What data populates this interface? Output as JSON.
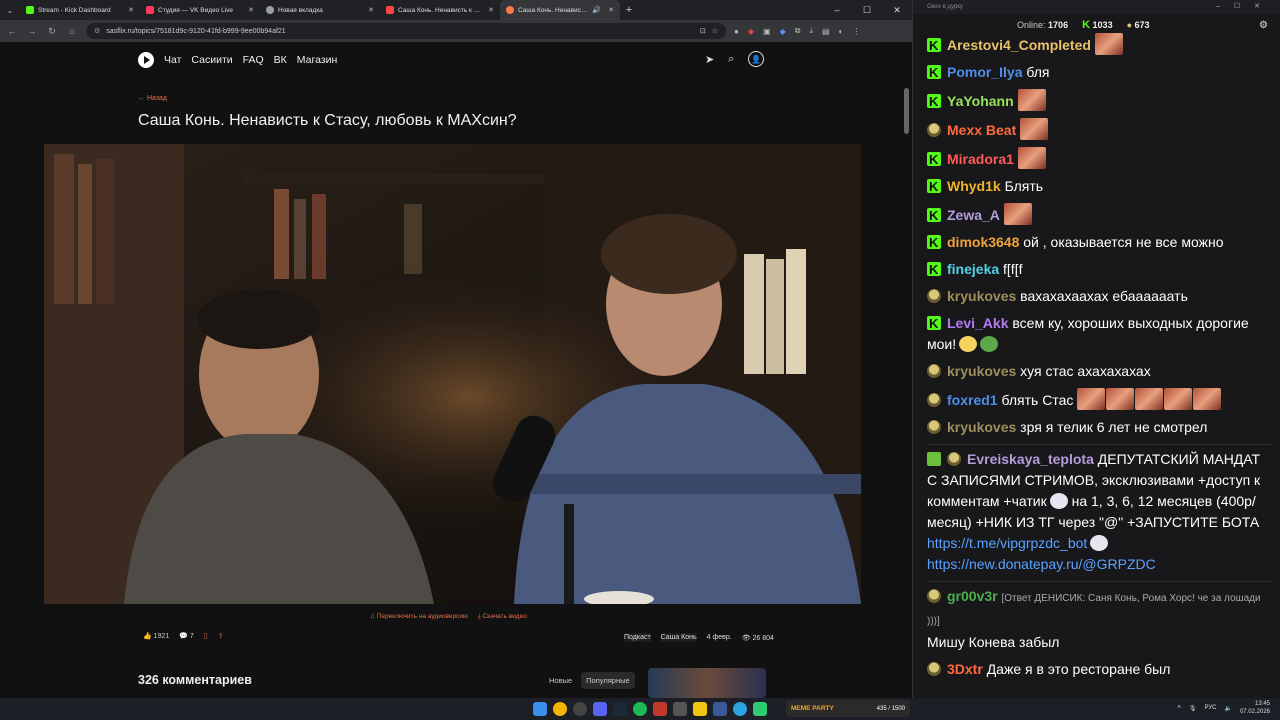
{
  "browser": {
    "tabs": [
      {
        "title": "Stream - Kick Dashboard",
        "color": "#53fc18"
      },
      {
        "title": "Студия — VK Видео Live",
        "color": "#ff3b5c"
      },
      {
        "title": "Новая вкладка",
        "color": "#9aa0a6"
      },
      {
        "title": "Саша Конь. Ненависть к Стас",
        "color": "#ff4444"
      },
      {
        "title": "Саша Конь. Ненависть к С",
        "color": "#ff7a45"
      }
    ],
    "url": "sasflix.ru/topics/75181d9c-9120-41fd-b999-9ee00b94af21"
  },
  "site": {
    "nav": [
      "Чат",
      "Сасиити",
      "FAQ",
      "ВК",
      "Магазин"
    ],
    "back": "← Назад",
    "title": "Саша Конь. Ненависть к Стасу, любовь к МАХсин?",
    "audio_link": "Переключить на аудиоверсию",
    "download_link": "Скачать видео",
    "likes": "1921",
    "comments_count_small": "7",
    "tag1": "Подкаст",
    "tag2": "Саша Конь",
    "date": "4 февр.",
    "views": "26 804",
    "comments_title": "326 комментариев",
    "sort_new": "Новые",
    "sort_popular": "Популярные"
  },
  "chat": {
    "window_title": "Окно в дурку",
    "online_label": "Online:",
    "online": "1706",
    "followers": "1033",
    "subs": "673",
    "messages": [
      {
        "badge": "kick",
        "user": "Arestovi4_Completed",
        "color": "#e8c06a",
        "text": "",
        "emotes": 1
      },
      {
        "badge": "kick",
        "user": "Pomor_Ilya",
        "color": "#4f8fea",
        "text": "бля",
        "emotes": 0
      },
      {
        "badge": "kick",
        "user": "YaYohann",
        "color": "#9be15d",
        "text": "",
        "emotes": 1
      },
      {
        "badge": "sub",
        "user": "Mexx Beat",
        "color": "#ff6a3d",
        "text": "",
        "emotes": 1
      },
      {
        "badge": "kick",
        "user": "Miradora1",
        "color": "#ff5b5b",
        "text": "",
        "emotes": 1
      },
      {
        "badge": "kick",
        "user": "Whyd1k",
        "color": "#f0b429",
        "text": "Блять",
        "emotes": 0
      },
      {
        "badge": "kick",
        "user": "Zewa_A",
        "color": "#b39ddb",
        "text": "",
        "emotes": 1
      },
      {
        "badge": "kick",
        "user": "dimok3648",
        "color": "#f0a33a",
        "text": "ой , оказывается не все можно",
        "emotes": 0
      },
      {
        "badge": "kick",
        "user": "finejeka",
        "color": "#4fd1e8",
        "text": "f[f[f",
        "emotes": 0
      },
      {
        "badge": "sub",
        "user": "kryukoves",
        "color": "#9e8e5a",
        "text": "вахахахаахах ебаааааать",
        "emotes": 0
      },
      {
        "badge": "kick",
        "user": "Levi_Akk",
        "color": "#b57cf2",
        "text": "всем ку, хороших выходных дорогие мои!",
        "emotes": 0
      },
      {
        "badge": "sub",
        "user": "kryukoves",
        "color": "#9e8e5a",
        "text": "хуя стас ахахахахах",
        "emotes": 0
      },
      {
        "badge": "sub",
        "user": "foxred1",
        "color": "#4f8fea",
        "text": "блять Стас",
        "emotes": 5
      },
      {
        "badge": "sub",
        "user": "kryukoves",
        "color": "#9e8e5a",
        "text": "зря я телик 6 лет не смотрел",
        "emotes": 0
      }
    ],
    "promo": {
      "user": "Evreiskaya_teplota",
      "color": "#b39ddb",
      "text1": "ДЕПУТАТСКИЙ МАНДАТ С ЗАПИСЯМИ СТРИМОВ, эксклюзивами +доступ к комментам +чатик",
      "text2": "на 1, 3, 6, 12 месяцев (400р/месяц) +НИК ИЗ ТГ через \"@\" +ЗАПУСТИТЕ БОТА",
      "link1": "https://t.me/vipgrpzdc_bot",
      "link2": "https://new.donatepay.ru/@GRPZDC"
    },
    "reply": {
      "user": "gr00v3r",
      "color": "#4caf50",
      "quote": "[Ответ ДЕНИСИК: Саня Конь, Рома Хорс! че за лошади )))]",
      "text": "Мишу Конева забыл"
    },
    "last": {
      "user": "3Dxtr",
      "color": "#ff6a3d",
      "text": "Даже я в это ресторане был"
    }
  },
  "taskbar": {
    "widget_brand": "MEME PARTY",
    "widget_progress": "435 / 1500",
    "lang": "РУС",
    "time": "13:45",
    "date": "07.02.2026"
  }
}
